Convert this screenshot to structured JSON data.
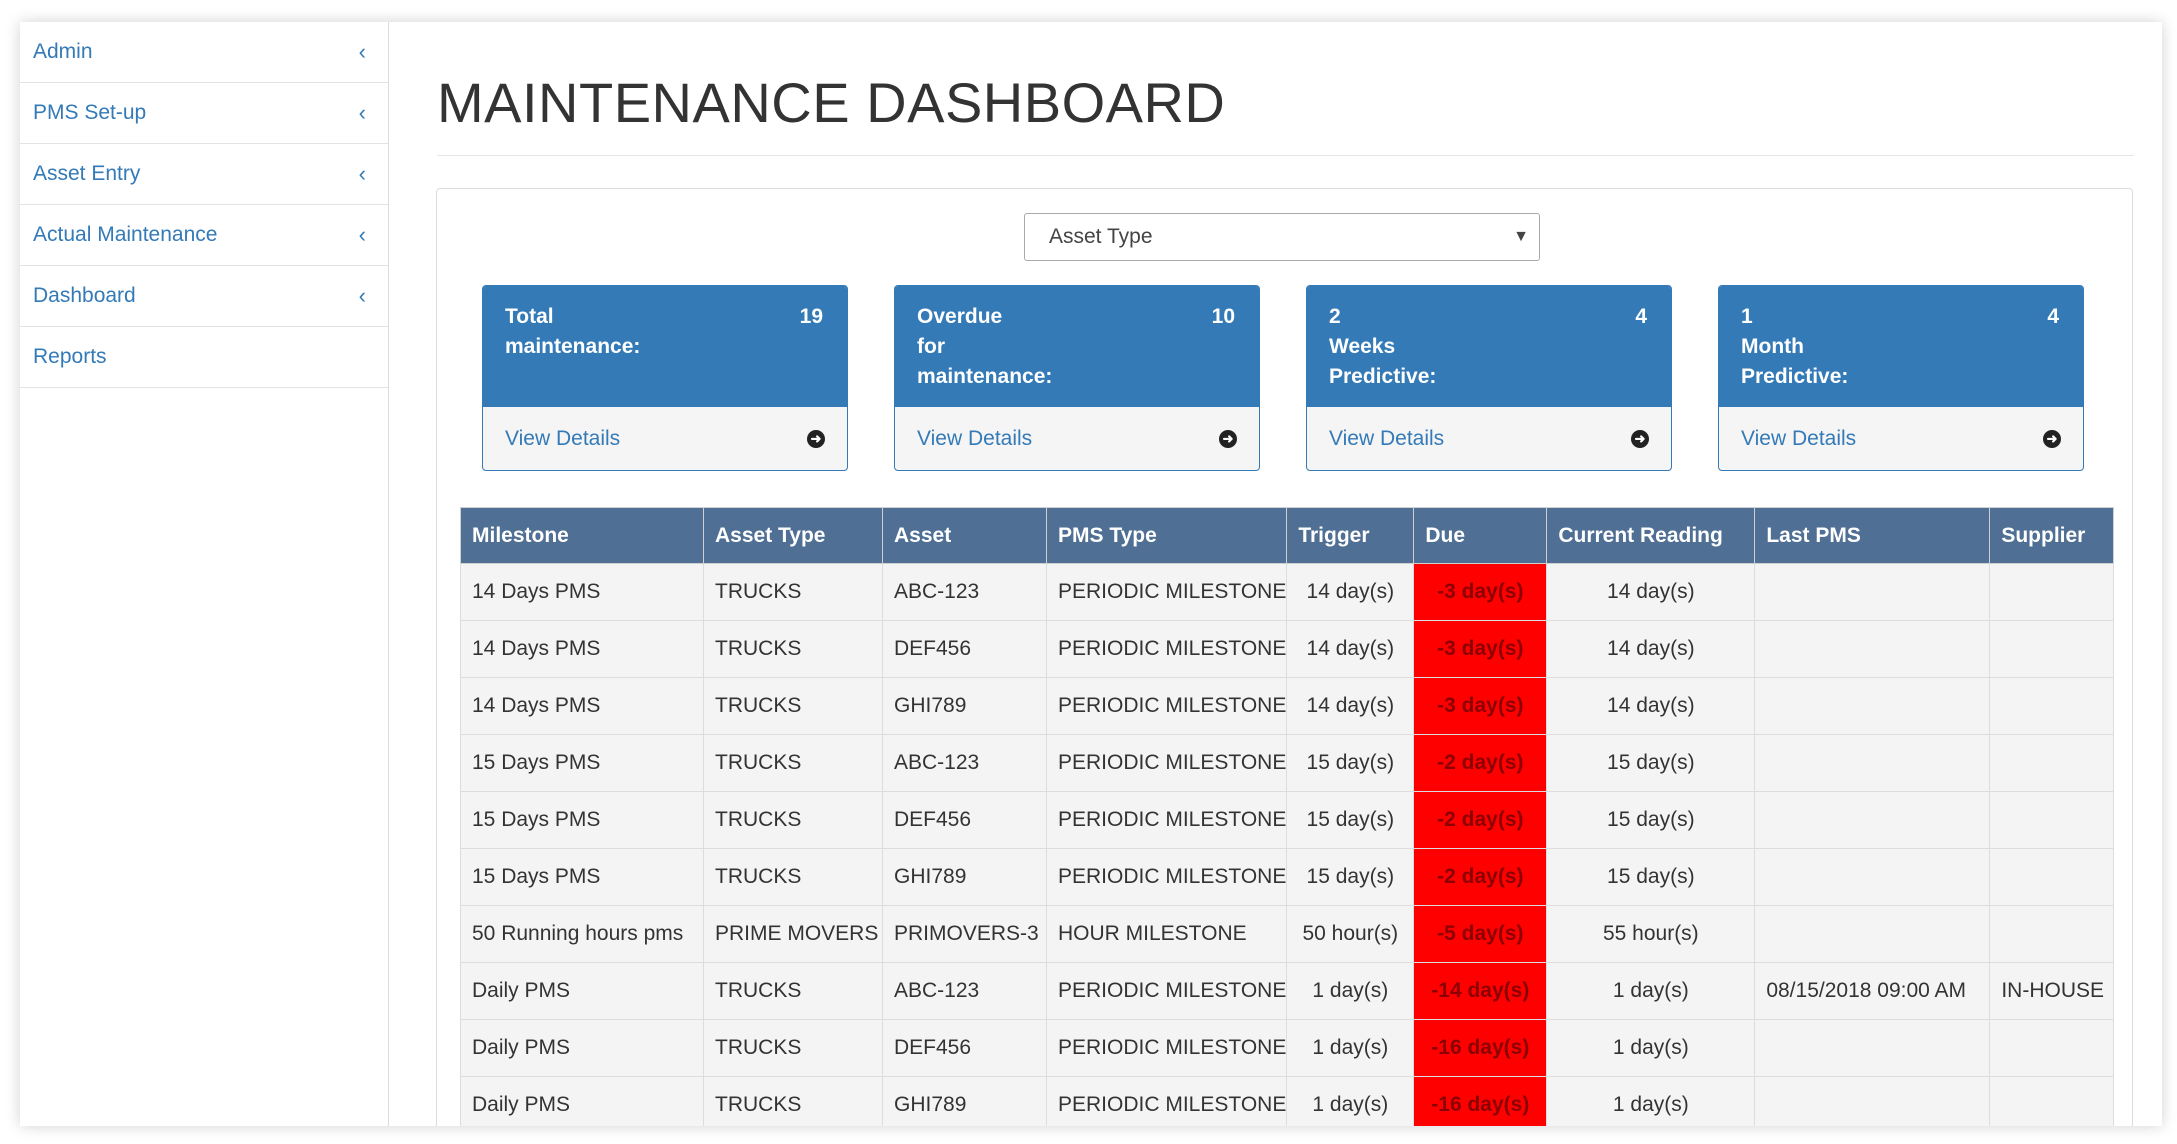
{
  "sidebar": {
    "items": [
      {
        "label": "Admin",
        "chevron": "‹"
      },
      {
        "label": "PMS Set-up",
        "chevron": "‹"
      },
      {
        "label": "Asset Entry",
        "chevron": "‹"
      },
      {
        "label": "Actual Maintenance",
        "chevron": "‹"
      },
      {
        "label": "Dashboard",
        "chevron": "‹"
      },
      {
        "label": "Reports",
        "chevron": ""
      }
    ]
  },
  "page": {
    "title": "MAINTENANCE DASHBOARD"
  },
  "filter": {
    "asset_type": "Asset Type",
    "arrow": "▼"
  },
  "cards": [
    {
      "label": "Total\nmaintenance:",
      "count": "19",
      "link": "View Details",
      "arrow_icon": "arrow-circle-right-icon"
    },
    {
      "label": "Overdue\nfor\nmaintenance:",
      "count": "10",
      "link": "View Details",
      "arrow_icon": "arrow-circle-right-icon"
    },
    {
      "label": "2\nWeeks\nPredictive:",
      "count": "4",
      "link": "View Details",
      "arrow_icon": "arrow-circle-right-icon"
    },
    {
      "label": "1\nMonth\nPredictive:",
      "count": "4",
      "link": "View Details",
      "arrow_icon": "arrow-circle-right-icon"
    }
  ],
  "table": {
    "headers": [
      "Milestone",
      "Asset Type",
      "Asset",
      "PMS Type",
      "Trigger",
      "Due",
      "Current Reading",
      "Last PMS",
      "Supplier"
    ],
    "rows": [
      [
        "14 Days PMS",
        "TRUCKS",
        "ABC-123",
        "PERIODIC MILESTONE",
        "14 day(s)",
        "-3 day(s)",
        "14 day(s)",
        "",
        ""
      ],
      [
        "14 Days PMS",
        "TRUCKS",
        "DEF456",
        "PERIODIC MILESTONE",
        "14 day(s)",
        "-3 day(s)",
        "14 day(s)",
        "",
        ""
      ],
      [
        "14 Days PMS",
        "TRUCKS",
        "GHI789",
        "PERIODIC MILESTONE",
        "14 day(s)",
        "-3 day(s)",
        "14 day(s)",
        "",
        ""
      ],
      [
        "15 Days PMS",
        "TRUCKS",
        "ABC-123",
        "PERIODIC MILESTONE",
        "15 day(s)",
        "-2 day(s)",
        "15 day(s)",
        "",
        ""
      ],
      [
        "15 Days PMS",
        "TRUCKS",
        "DEF456",
        "PERIODIC MILESTONE",
        "15 day(s)",
        "-2 day(s)",
        "15 day(s)",
        "",
        ""
      ],
      [
        "15 Days PMS",
        "TRUCKS",
        "GHI789",
        "PERIODIC MILESTONE",
        "15 day(s)",
        "-2 day(s)",
        "15 day(s)",
        "",
        ""
      ],
      [
        "50 Running hours pms",
        "PRIME MOVERS",
        "PRIMOVERS-3",
        "HOUR MILESTONE",
        "50 hour(s)",
        "-5 day(s)",
        "55 hour(s)",
        "",
        ""
      ],
      [
        "Daily PMS",
        "TRUCKS",
        "ABC-123",
        "PERIODIC MILESTONE",
        "1 day(s)",
        "-14 day(s)",
        "1 day(s)",
        "08/15/2018 09:00 AM",
        "IN-HOUSE"
      ],
      [
        "Daily PMS",
        "TRUCKS",
        "DEF456",
        "PERIODIC MILESTONE",
        "1 day(s)",
        "-16 day(s)",
        "1 day(s)",
        "",
        ""
      ],
      [
        "Daily PMS",
        "TRUCKS",
        "GHI789",
        "PERIODIC MILESTONE",
        "1 day(s)",
        "-16 day(s)",
        "1 day(s)",
        "",
        ""
      ]
    ]
  },
  "colors": {
    "brand": "#337ab7",
    "table_header": "#4f6f94",
    "overdue": "#ff0000"
  }
}
